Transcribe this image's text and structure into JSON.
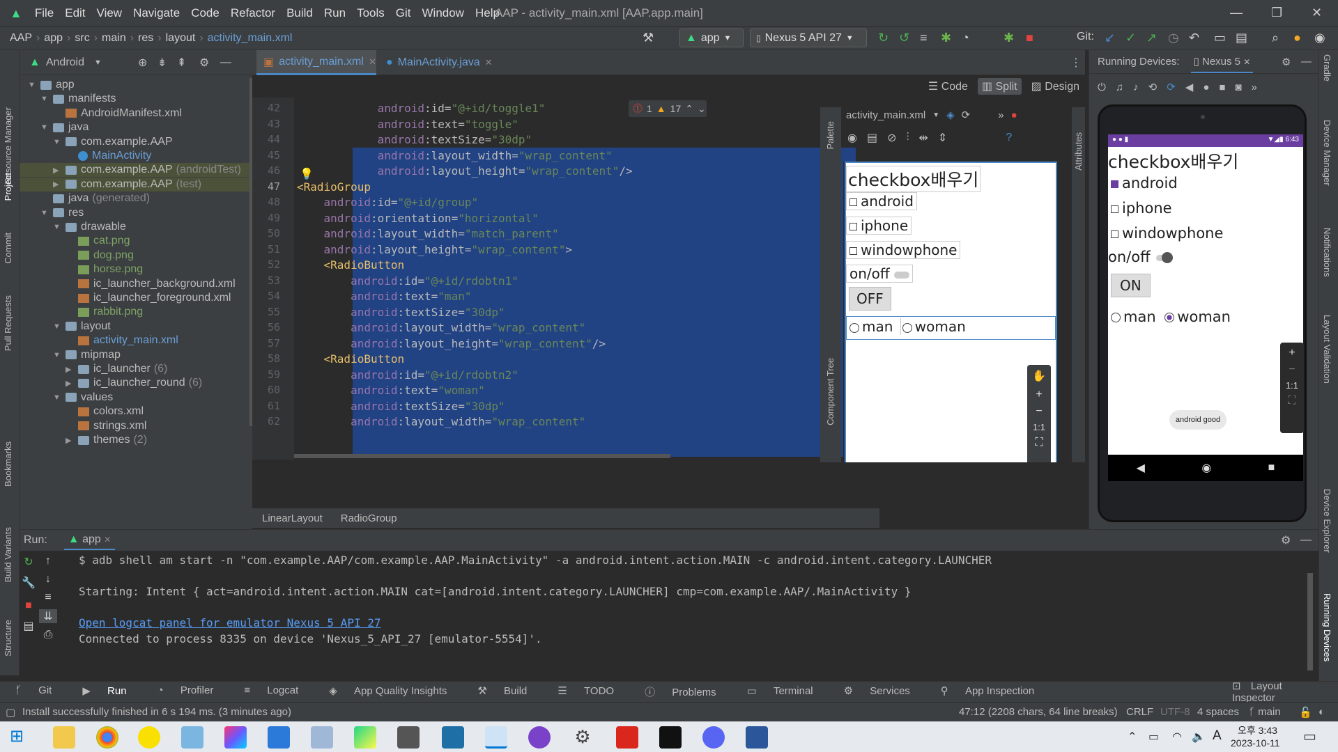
{
  "title_bar": {
    "menu": [
      "File",
      "Edit",
      "View",
      "Navigate",
      "Code",
      "Refactor",
      "Build",
      "Run",
      "Tools",
      "Git",
      "Window",
      "Help"
    ],
    "title": "AAP - activity_main.xml [AAP.app.main]"
  },
  "breadcrumb": [
    "AAP",
    "app",
    "src",
    "main",
    "res",
    "layout",
    "activity_main.xml"
  ],
  "toolbar": {
    "run_config": "app",
    "device": "Nexus 5 API 27",
    "git_label": "Git:"
  },
  "project": {
    "view_selector": "Android",
    "tree": [
      {
        "label": "app",
        "level": 0,
        "kind": "folder",
        "expanded": true
      },
      {
        "label": "manifests",
        "level": 1,
        "kind": "folder",
        "expanded": true
      },
      {
        "label": "AndroidManifest.xml",
        "level": 2,
        "kind": "xml"
      },
      {
        "label": "java",
        "level": 1,
        "kind": "folder",
        "expanded": true
      },
      {
        "label": "com.example.AAP",
        "level": 2,
        "kind": "folder",
        "expanded": true
      },
      {
        "label": "MainActivity",
        "level": 3,
        "kind": "class"
      },
      {
        "label": "com.example.AAP",
        "suffix": "(androidTest)",
        "level": 2,
        "kind": "folder",
        "collapsed": true
      },
      {
        "label": "com.example.AAP",
        "suffix": "(test)",
        "level": 2,
        "kind": "folder",
        "collapsed": true
      },
      {
        "label": "java",
        "suffix": "(generated)",
        "level": 1,
        "kind": "folder"
      },
      {
        "label": "res",
        "level": 1,
        "kind": "folder",
        "expanded": true
      },
      {
        "label": "drawable",
        "level": 2,
        "kind": "folder",
        "expanded": true
      },
      {
        "label": "cat.png",
        "level": 3,
        "kind": "png"
      },
      {
        "label": "dog.png",
        "level": 3,
        "kind": "png"
      },
      {
        "label": "horse.png",
        "level": 3,
        "kind": "png"
      },
      {
        "label": "ic_launcher_background.xml",
        "level": 3,
        "kind": "xml"
      },
      {
        "label": "ic_launcher_foreground.xml",
        "level": 3,
        "kind": "xml"
      },
      {
        "label": "rabbit.png",
        "level": 3,
        "kind": "png"
      },
      {
        "label": "layout",
        "level": 2,
        "kind": "folder",
        "expanded": true
      },
      {
        "label": "activity_main.xml",
        "level": 3,
        "kind": "xml"
      },
      {
        "label": "mipmap",
        "level": 2,
        "kind": "folder",
        "expanded": true
      },
      {
        "label": "ic_launcher",
        "suffix": "(6)",
        "level": 3,
        "kind": "folder",
        "collapsed": true
      },
      {
        "label": "ic_launcher_round",
        "suffix": "(6)",
        "level": 3,
        "kind": "folder",
        "collapsed": true
      },
      {
        "label": "values",
        "level": 2,
        "kind": "folder",
        "expanded": true
      },
      {
        "label": "colors.xml",
        "level": 3,
        "kind": "xml"
      },
      {
        "label": "strings.xml",
        "level": 3,
        "kind": "xml"
      },
      {
        "label": "themes",
        "suffix": "(2)",
        "level": 3,
        "kind": "folder",
        "collapsed": true
      }
    ]
  },
  "editor": {
    "tabs": [
      "activity_main.xml",
      "MainActivity.java"
    ],
    "view_modes": [
      "Code",
      "Split",
      "Design"
    ],
    "error_count": "1",
    "warning_count": "17",
    "lines": [
      {
        "n": "42",
        "indent": "            ",
        "parts": [
          [
            "attr",
            "android"
          ],
          [
            "nm",
            ":id="
          ],
          [
            "val",
            "\"@+id/toggle1\""
          ]
        ]
      },
      {
        "n": "43",
        "indent": "            ",
        "parts": [
          [
            "attr",
            "android"
          ],
          [
            "nm",
            ":text="
          ],
          [
            "val",
            "\"toggle\""
          ]
        ]
      },
      {
        "n": "44",
        "indent": "            ",
        "parts": [
          [
            "attr",
            "android"
          ],
          [
            "nm",
            ":textSize="
          ],
          [
            "val",
            "\"30dp\""
          ]
        ]
      },
      {
        "n": "45",
        "indent": "            ",
        "parts": [
          [
            "attr",
            "android"
          ],
          [
            "nm",
            ":layout_width="
          ],
          [
            "val",
            "\"wrap_content\""
          ]
        ]
      },
      {
        "n": "46",
        "indent": "            ",
        "parts": [
          [
            "attr",
            "android"
          ],
          [
            "nm",
            ":layout_height="
          ],
          [
            "val",
            "\"wrap_content\""
          ],
          [
            "nm",
            "/>"
          ]
        ]
      },
      {
        "n": "47",
        "indent": "",
        "parts": [
          [
            "tag",
            "<RadioGroup"
          ]
        ]
      },
      {
        "n": "48",
        "indent": "    ",
        "parts": [
          [
            "attr",
            "android"
          ],
          [
            "nm",
            ":id="
          ],
          [
            "val",
            "\"@+id/group\""
          ]
        ]
      },
      {
        "n": "49",
        "indent": "    ",
        "parts": [
          [
            "attr",
            "android"
          ],
          [
            "nm",
            ":orientation="
          ],
          [
            "val",
            "\"horizontal\""
          ]
        ]
      },
      {
        "n": "50",
        "indent": "    ",
        "parts": [
          [
            "attr",
            "android"
          ],
          [
            "nm",
            ":layout_width="
          ],
          [
            "val",
            "\"match_parent\""
          ]
        ]
      },
      {
        "n": "51",
        "indent": "    ",
        "parts": [
          [
            "attr",
            "android"
          ],
          [
            "nm",
            ":layout_height="
          ],
          [
            "val",
            "\"wrap_content\""
          ],
          [
            "nm",
            ">"
          ]
        ]
      },
      {
        "n": "52",
        "indent": "    ",
        "parts": [
          [
            "tag",
            "<RadioButton"
          ]
        ]
      },
      {
        "n": "53",
        "indent": "        ",
        "parts": [
          [
            "attr",
            "android"
          ],
          [
            "nm",
            ":id="
          ],
          [
            "val",
            "\"@+id/rdobtn1\""
          ]
        ]
      },
      {
        "n": "54",
        "indent": "        ",
        "parts": [
          [
            "attr",
            "android"
          ],
          [
            "nm",
            ":text="
          ],
          [
            "val",
            "\"man\""
          ]
        ]
      },
      {
        "n": "55",
        "indent": "        ",
        "parts": [
          [
            "attr",
            "android"
          ],
          [
            "nm",
            ":textSize="
          ],
          [
            "val",
            "\"30dp\""
          ]
        ]
      },
      {
        "n": "56",
        "indent": "        ",
        "parts": [
          [
            "attr",
            "android"
          ],
          [
            "nm",
            ":layout_width="
          ],
          [
            "val",
            "\"wrap_content\""
          ]
        ]
      },
      {
        "n": "57",
        "indent": "        ",
        "parts": [
          [
            "attr",
            "android"
          ],
          [
            "nm",
            ":layout_height="
          ],
          [
            "val",
            "\"wrap_content\""
          ],
          [
            "nm",
            "/>"
          ]
        ]
      },
      {
        "n": "58",
        "indent": "    ",
        "parts": [
          [
            "tag",
            "<RadioButton"
          ]
        ]
      },
      {
        "n": "59",
        "indent": "        ",
        "parts": [
          [
            "attr",
            "android"
          ],
          [
            "nm",
            ":id="
          ],
          [
            "val",
            "\"@+id/rdobtn2\""
          ]
        ]
      },
      {
        "n": "60",
        "indent": "        ",
        "parts": [
          [
            "attr",
            "android"
          ],
          [
            "nm",
            ":text="
          ],
          [
            "val",
            "\"woman\""
          ]
        ]
      },
      {
        "n": "61",
        "indent": "        ",
        "parts": [
          [
            "attr",
            "android"
          ],
          [
            "nm",
            ":textSize="
          ],
          [
            "val",
            "\"30dp\""
          ]
        ]
      },
      {
        "n": "62",
        "indent": "        ",
        "parts": [
          [
            "attr",
            "android"
          ],
          [
            "nm",
            ":layout_width="
          ],
          [
            "val",
            "\"wrap_content\""
          ]
        ]
      }
    ],
    "breadcrumb_bottom": [
      "LinearLayout",
      "RadioGroup"
    ],
    "design_file_selector": "activity_main.xml",
    "side_labels": [
      "Palette",
      "Component Tree",
      "Attributes"
    ]
  },
  "preview": {
    "title": "checkbox배우기",
    "checkboxes": [
      "android",
      "iphone",
      "windowphone"
    ],
    "toggle_label": "on/off",
    "toggle_button": "OFF",
    "radios": [
      "man",
      "woman"
    ],
    "zoom_fit": "1:1"
  },
  "running_devices": {
    "label": "Running Devices:",
    "tab": "Nexus 5",
    "status_time": "6:43",
    "title": "checkbox배우기",
    "checkboxes": [
      {
        "label": "android",
        "checked": true
      },
      {
        "label": "iphone",
        "checked": false
      },
      {
        "label": "windowphone",
        "checked": false
      }
    ],
    "toggle_label": "on/off",
    "toggle_button": "ON",
    "radios": [
      {
        "label": "man",
        "checked": false
      },
      {
        "label": "woman",
        "checked": true
      }
    ],
    "toast": "android good",
    "zoom_fit": "1:1"
  },
  "run_panel": {
    "label": "Run:",
    "tab": "app",
    "lines": [
      "$ adb shell am start -n \"com.example.AAP/com.example.AAP.MainActivity\" -a android.intent.action.MAIN -c android.intent.category.LAUNCHER",
      "",
      "Starting: Intent { act=android.intent.action.MAIN cat=[android.intent.category.LAUNCHER] cmp=com.example.AAP/.MainActivity }",
      "",
      "Open logcat panel for emulator Nexus 5 API 27",
      "Connected to process 8335 on device 'Nexus_5_API_27 [emulator-5554]'."
    ]
  },
  "bottom_tools": [
    "Git",
    "Run",
    "Profiler",
    "Logcat",
    "App Quality Insights",
    "Build",
    "TODO",
    "Problems",
    "Terminal",
    "Services",
    "App Inspection"
  ],
  "layout_inspector": "Layout Inspector",
  "status_bar": {
    "message": "Install successfully finished in 6 s 194 ms. (3 minutes ago)",
    "position": "47:12 (2208 chars, 64 line breaks)",
    "line_sep": "CRLF",
    "encoding": "UTF-8",
    "indent": "4 spaces",
    "branch": "main"
  },
  "left_strip_labels": [
    "Resource Manager",
    "Project",
    "Commit",
    "Pull Requests",
    "Bookmarks",
    "Build Variants",
    "Structure"
  ],
  "right_strip_labels": [
    "Gradle",
    "Device Manager",
    "Notifications",
    "Layout Validation",
    "Device Explorer",
    "Running Devices"
  ],
  "taskbar": {
    "ime": "A",
    "time": "오후 3:43",
    "date": "2023-10-11"
  }
}
